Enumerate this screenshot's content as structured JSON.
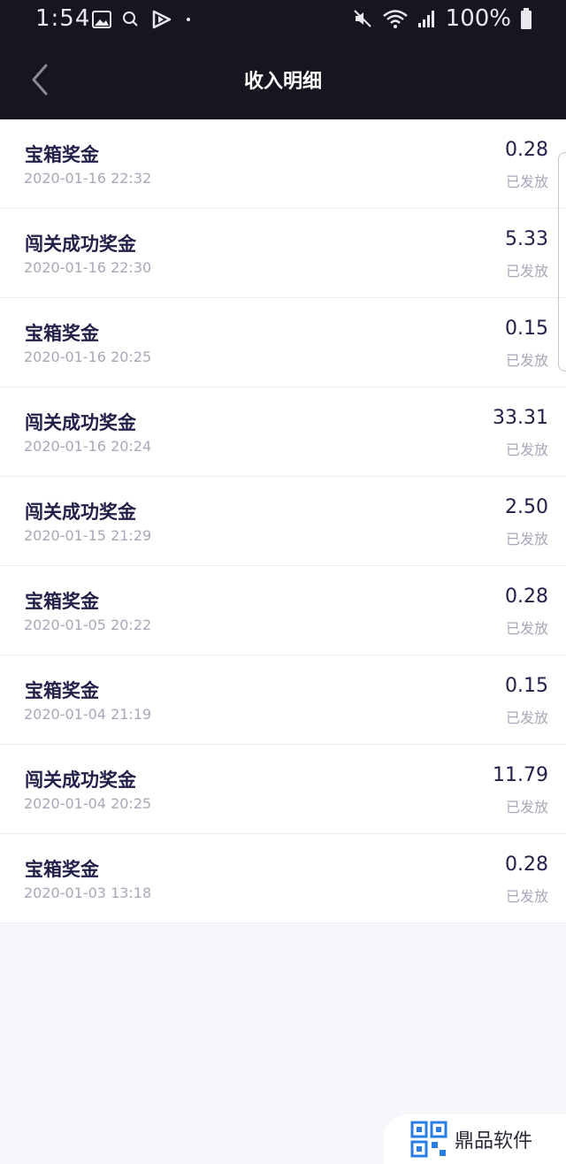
{
  "status_bar": {
    "time": "1:54",
    "battery": "100%"
  },
  "header": {
    "title": "收入明细"
  },
  "records": [
    {
      "title": "宝箱奖金",
      "date": "2020-01-16 22:32",
      "amount": "0.28",
      "status": "已发放"
    },
    {
      "title": "闯关成功奖金",
      "date": "2020-01-16 22:30",
      "amount": "5.33",
      "status": "已发放"
    },
    {
      "title": "宝箱奖金",
      "date": "2020-01-16 20:25",
      "amount": "0.15",
      "status": "已发放"
    },
    {
      "title": "闯关成功奖金",
      "date": "2020-01-16 20:24",
      "amount": "33.31",
      "status": "已发放"
    },
    {
      "title": "闯关成功奖金",
      "date": "2020-01-15 21:29",
      "amount": "2.50",
      "status": "已发放"
    },
    {
      "title": "宝箱奖金",
      "date": "2020-01-05 20:22",
      "amount": "0.28",
      "status": "已发放"
    },
    {
      "title": "宝箱奖金",
      "date": "2020-01-04 21:19",
      "amount": "0.15",
      "status": "已发放"
    },
    {
      "title": "闯关成功奖金",
      "date": "2020-01-04 20:25",
      "amount": "11.79",
      "status": "已发放"
    },
    {
      "title": "宝箱奖金",
      "date": "2020-01-03 13:18",
      "amount": "0.28",
      "status": "已发放"
    }
  ],
  "watermark": {
    "text": "鼎品软件"
  },
  "icons": {
    "status_left": [
      "image-icon",
      "search-icon",
      "play-icon",
      "dot-icon"
    ],
    "status_right": [
      "mute-icon",
      "wifi-icon",
      "signal-icon",
      "battery-icon"
    ],
    "back": "chevron-left-icon"
  },
  "colors": {
    "header_bg": "#15161f",
    "title_text": "#23214a",
    "secondary_text": "#a8a8b8",
    "page_bg": "#f7f7fb"
  }
}
